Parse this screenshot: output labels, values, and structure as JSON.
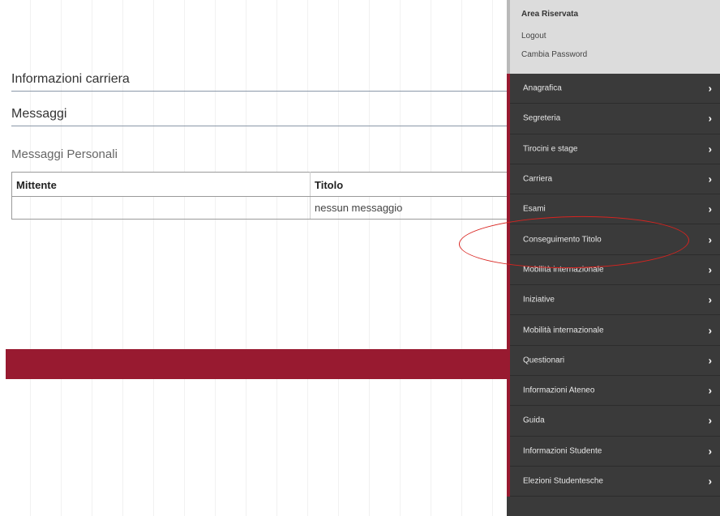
{
  "main": {
    "section_career": "Informazioni carriera",
    "section_messages": "Messaggi",
    "messages_subtitle": "Messaggi Personali",
    "table": {
      "headers": [
        "Mittente",
        "Titolo"
      ],
      "rows": [
        [
          "",
          "nessun messaggio"
        ]
      ]
    }
  },
  "sidebar": {
    "title": "Area Riservata",
    "logout": "Logout",
    "change_password": "Cambia Password",
    "items": [
      {
        "label": "Anagrafica"
      },
      {
        "label": "Segreteria"
      },
      {
        "label": "Tirocini e stage"
      },
      {
        "label": "Carriera"
      },
      {
        "label": "Esami"
      },
      {
        "label": "Conseguimento Titolo"
      },
      {
        "label": "Mobilità internazionale"
      },
      {
        "label": "Iniziative"
      },
      {
        "label": "Mobilità internazionale"
      },
      {
        "label": "Questionari"
      },
      {
        "label": "Informazioni Ateneo"
      },
      {
        "label": "Guida"
      },
      {
        "label": "Informazioni Studente"
      },
      {
        "label": "Elezioni Studentesche"
      }
    ],
    "chevron": "›"
  },
  "colors": {
    "accent": "#981a30",
    "sidebar_bg": "#3a3a3a",
    "sidebar_top_bg": "#dcdcdc",
    "annotation": "#d9231f"
  }
}
